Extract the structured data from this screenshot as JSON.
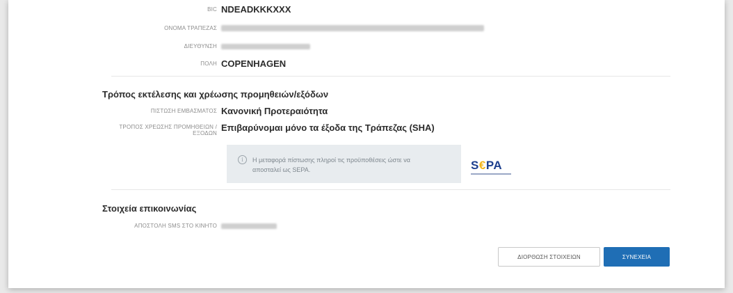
{
  "bank_details": {
    "bic_label": "BIC",
    "bic_value": "NDEADKKKXXX",
    "bank_name_label": "ΟΝΟΜΑ ΤΡΑΠΕΖΑΣ",
    "address_label": "ΔΙΕΥΘΥΝΣΗ",
    "city_label": "ΠΟΛΗ",
    "city_value": "COPENHAGEN"
  },
  "execution": {
    "title": "Τρόπος εκτέλεσης και χρέωσης προμηθειών/εξόδων",
    "credit_label": "ΠΙΣΤΩΣΗ ΕΜΒΑΣΜΑΤΟΣ",
    "credit_value": "Κανονική Προτεραιότητα",
    "charges_label_line1": "ΤΡΟΠΟΣ ΧΡΕΩΣΗΣ ΠΡΟΜΗΘΕΙΩΝ /",
    "charges_label_line2": "ΕΞΟΔΩΝ",
    "charges_value": "Επιβαρύνομαι μόνο τα έξοδα της Τράπεζας (SHA)",
    "info_icon": "info-circle-icon",
    "info_text": "Η μεταφορά πίστωσης πληροί τις προϋποθέσεις ώστε να αποσταλεί ως SEPA.",
    "sepa_logo_prefix": "S",
    "sepa_logo_e": "€",
    "sepa_logo_suffix": "PA"
  },
  "contact": {
    "title": "Στοιχεία επικοινωνίας",
    "sms_label": "ΑΠΟΣΤΟΛΗ SMS ΣΤΟ ΚΙΝΗΤΟ"
  },
  "actions": {
    "edit_label": "ΔΙΟΡΘΩΣΗ ΣΤΟΙΧΕΙΩΝ",
    "continue_label": "ΣΥΝΕΧΕΙΑ"
  },
  "colors": {
    "primary": "#1f6eb5",
    "info_bg": "#e8ecef",
    "sepa_blue": "#1d3f8e",
    "sepa_yellow": "#f2b51b"
  }
}
